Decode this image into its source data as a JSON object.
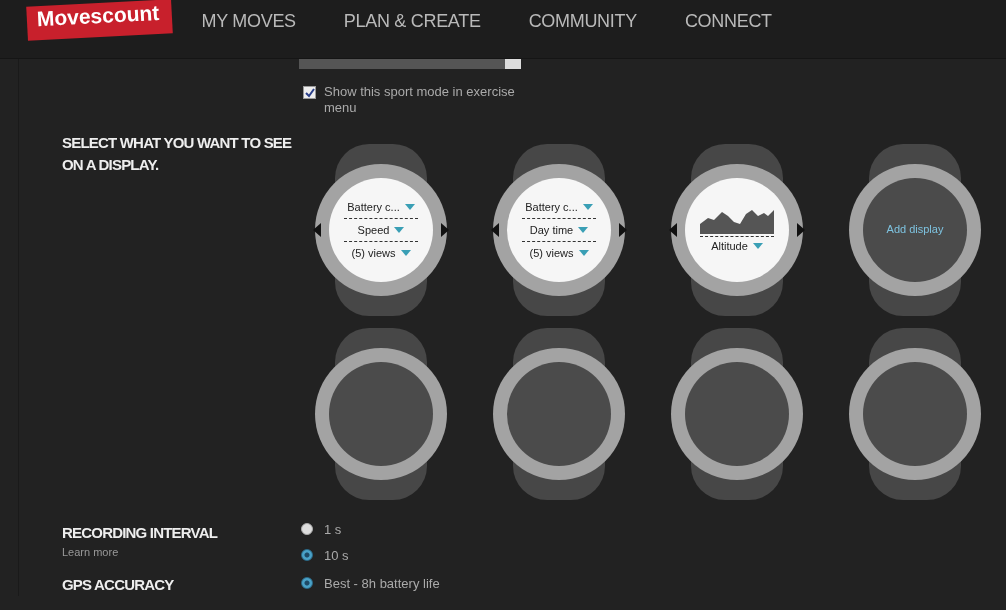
{
  "header": {
    "logo": "Movescount",
    "nav": [
      {
        "label": "MY MOVES"
      },
      {
        "label": "PLAN & CREATE"
      },
      {
        "label": "COMMUNITY"
      },
      {
        "label": "CONNECT"
      }
    ]
  },
  "show_in_menu": {
    "label": "Show this sport mode in exercise menu",
    "checked": true
  },
  "display_section": {
    "title": "SELECT WHAT YOU WANT TO SEE ON A DISPLAY.",
    "displays": [
      {
        "kind": "fields",
        "rows": [
          "Battery c...",
          "Speed",
          "(5) views"
        ]
      },
      {
        "kind": "fields",
        "rows": [
          "Battery c...",
          "Day time",
          "(5) views"
        ]
      },
      {
        "kind": "graph",
        "rows": [
          "Altitude"
        ]
      },
      {
        "kind": "add",
        "label": "Add display"
      },
      {
        "kind": "empty"
      },
      {
        "kind": "empty"
      },
      {
        "kind": "empty"
      },
      {
        "kind": "empty"
      }
    ]
  },
  "recording_interval": {
    "title": "RECORDING INTERVAL",
    "link": "Learn more",
    "options": [
      {
        "label": "1 s",
        "selected": false
      },
      {
        "label": "10 s",
        "selected": true
      }
    ]
  },
  "gps_accuracy": {
    "title": "GPS ACCURACY",
    "options": [
      {
        "label": "Best - 8h battery life",
        "selected": true
      }
    ]
  }
}
